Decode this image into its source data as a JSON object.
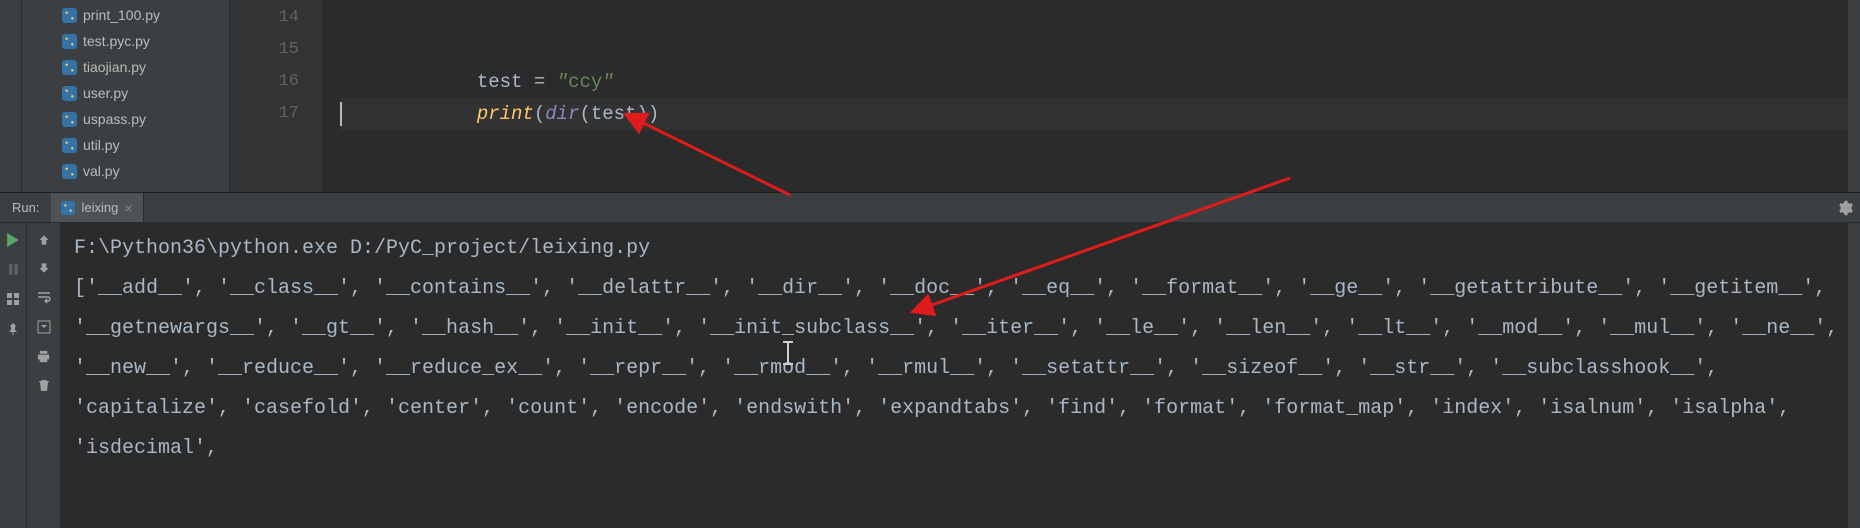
{
  "tree": {
    "files": [
      "print_100.py",
      "test.pyc.py",
      "tiaojian.py",
      "user.py",
      "uspass.py",
      "util.py",
      "val.py"
    ]
  },
  "editor": {
    "lines": [
      "14",
      "15",
      "16",
      "17"
    ],
    "code": {
      "var_name": "test",
      "var_value": "ccy",
      "fn_print": "print",
      "fn_dir": "dir",
      "arg": "test"
    }
  },
  "run": {
    "title": "Run:",
    "active_config": "leixing",
    "output": {
      "cmdline": "F:\\Python36\\python.exe D:/PyC_project/leixing.py",
      "stdout": "['__add__', '__class__', '__contains__', '__delattr__', '__dir__', '__doc__', '__eq__', '__format__', '__ge__', '__getattribute__', '__getitem__', '__getnewargs__', '__gt__', '__hash__', '__init__', '__init_subclass__', '__iter__', '__le__', '__len__', '__lt__', '__mod__', '__mul__', '__ne__', '__new__', '__reduce__', '__reduce_ex__', '__repr__', '__rmod__', '__rmul__', '__setattr__', '__sizeof__', '__str__', '__subclasshook__', 'capitalize', 'casefold', 'center', 'count', 'encode', 'endswith', 'expandtabs', 'find', 'format', 'format_map', 'index', 'isalnum', 'isalpha', 'isdecimal',"
    }
  },
  "colors": {
    "bg": "#2b2b2b",
    "panel": "#3c3f41",
    "gutter": "#313335",
    "string": "#6a8759",
    "builtin": "#ffc66d",
    "fn": "#8888c6",
    "text": "#a9b7c6",
    "run_green": "#59a869",
    "annotation_red": "#e01b1b"
  }
}
